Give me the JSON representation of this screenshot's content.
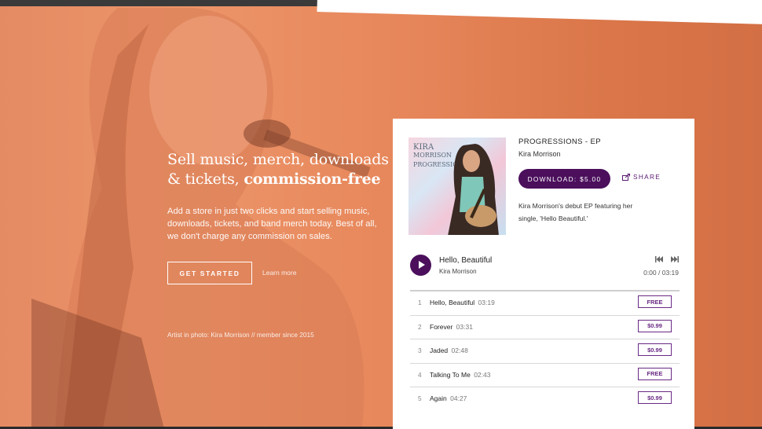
{
  "hero": {
    "headline_part1": "Sell music, merch, downloads & tickets,",
    "headline_bold": "commission-free",
    "subtext": "Add a store in just two clicks and start selling music, downloads, tickets, and band merch today. Best of all, we don't charge any commission on sales.",
    "get_started": "GET STARTED",
    "learn_more": "Learn more",
    "credit": "Artist in photo: Kira Morrison // member since 2015"
  },
  "album": {
    "title": "PROGRESSIONS - EP",
    "artist": "Kira Morrison",
    "cover_text_1": "KIRA",
    "cover_text_2": "MORRISON",
    "cover_text_3": "PROGRESSIONS",
    "download_label": "DOWNLOAD: $5.00",
    "share_label": "SHARE",
    "description": "Kira Morrison's debut EP featuring her single, 'Hello Beautiful.'"
  },
  "player": {
    "title": "Hello, Beautiful",
    "artist": "Kira Morrison",
    "time": "0:00 / 03:19"
  },
  "tracks": [
    {
      "num": "1",
      "name": "Hello, Beautiful",
      "dur": "03:19",
      "price": "FREE"
    },
    {
      "num": "2",
      "name": "Forever",
      "dur": "03:31",
      "price": "$0.99"
    },
    {
      "num": "3",
      "name": "Jaded",
      "dur": "02:48",
      "price": "$0.99"
    },
    {
      "num": "4",
      "name": "Talking To Me",
      "dur": "02:43",
      "price": "FREE"
    },
    {
      "num": "5",
      "name": "Again",
      "dur": "04:27",
      "price": "$0.99"
    }
  ],
  "colors": {
    "accent": "#4b0f5c",
    "hero": "#e58b64"
  }
}
